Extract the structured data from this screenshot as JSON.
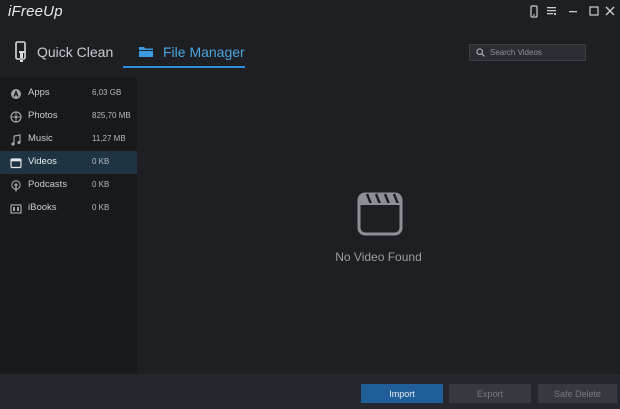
{
  "app": {
    "title": "iFreeUp"
  },
  "tabs": [
    {
      "label": "Quick Clean",
      "icon": "phone-brush-icon",
      "active": false
    },
    {
      "label": "File Manager",
      "icon": "folder-icon",
      "active": true
    }
  ],
  "search": {
    "placeholder": "Search Videos",
    "value": ""
  },
  "sidebar": {
    "items": [
      {
        "label": "Apps",
        "size": "6,03 GB",
        "icon": "apps-icon",
        "active": false
      },
      {
        "label": "Photos",
        "size": "825,70 MB",
        "icon": "photos-icon",
        "active": false
      },
      {
        "label": "Music",
        "size": "11,27 MB",
        "icon": "music-icon",
        "active": false
      },
      {
        "label": "Videos",
        "size": "0 KB",
        "icon": "videos-icon",
        "active": true
      },
      {
        "label": "Podcasts",
        "size": "0 KB",
        "icon": "podcasts-icon",
        "active": false
      },
      {
        "label": "iBooks",
        "size": "0 KB",
        "icon": "ibooks-icon",
        "active": false
      }
    ]
  },
  "main": {
    "empty_text": "No Video Found",
    "empty_icon": "clapperboard-icon"
  },
  "footer": {
    "import_label": "Import",
    "export_label": "Export",
    "delete_label": "Safe Delete"
  },
  "colors": {
    "accent": "#2e8fd6",
    "background": "#1d1f22",
    "sidebar": "#17191b",
    "selected_row": "#1f3442"
  }
}
